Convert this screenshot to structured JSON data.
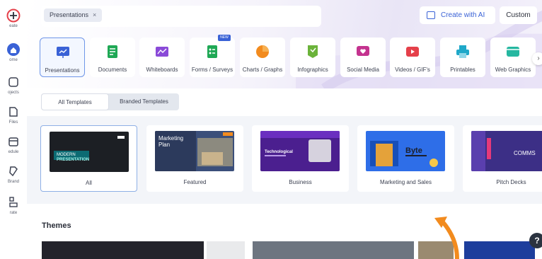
{
  "rail": {
    "items": [
      {
        "label": "eate",
        "icon": "plus-icon"
      },
      {
        "label": "ome",
        "icon": "home-icon"
      },
      {
        "label": "ojects",
        "icon": "projects-icon"
      },
      {
        "label": "Files",
        "icon": "files-icon"
      },
      {
        "label": "edule",
        "icon": "schedule-icon"
      },
      {
        "label": "Brand",
        "icon": "brand-icon"
      },
      {
        "label": "rate",
        "icon": "integrate-icon"
      }
    ]
  },
  "search": {
    "chip_label": "Presentations",
    "chip_close": "×"
  },
  "toolbar": {
    "create_ai_label": "Create with AI",
    "custom_label": "Custom"
  },
  "categories": [
    {
      "label": "Presentations",
      "color": "#3a62d6",
      "active": true
    },
    {
      "label": "Documents",
      "color": "#1fa855"
    },
    {
      "label": "Whiteboards",
      "color": "#8a4ad8"
    },
    {
      "label": "Forms / Surveys",
      "color": "#1fa855",
      "badge": "NEW"
    },
    {
      "label": "Charts / Graphs",
      "color": "#f28b1e"
    },
    {
      "label": "Infographics",
      "color": "#6bb33a"
    },
    {
      "label": "Social Media",
      "color": "#c4338f"
    },
    {
      "label": "Videos / GIF's",
      "color": "#e5404a"
    },
    {
      "label": "Printables",
      "color": "#1fa8c9"
    },
    {
      "label": "Web Graphics",
      "color": "#25b7a0"
    }
  ],
  "tabs": {
    "all_templates": "All Templates",
    "branded_templates": "Branded Templates"
  },
  "templates": [
    {
      "label": "All",
      "thumb_title_1": "MODERN",
      "thumb_title_2": "PRESENTATION"
    },
    {
      "label": "Featured",
      "thumb_title_1": "Marketing",
      "thumb_title_2": "Plan"
    },
    {
      "label": "Business",
      "thumb_title_1": "Technological",
      "thumb_title_2": ""
    },
    {
      "label": "Marketing and Sales",
      "thumb_title_1": "Byte",
      "thumb_title_2": ""
    },
    {
      "label": "Pitch Decks",
      "thumb_title_1": "COMMS",
      "thumb_title_2": ""
    }
  ],
  "themes": {
    "title": "Themes"
  },
  "help": {
    "label": "?"
  },
  "colors": {
    "accent": "#3a62d6",
    "annotation_arrow": "#f28b1e"
  }
}
